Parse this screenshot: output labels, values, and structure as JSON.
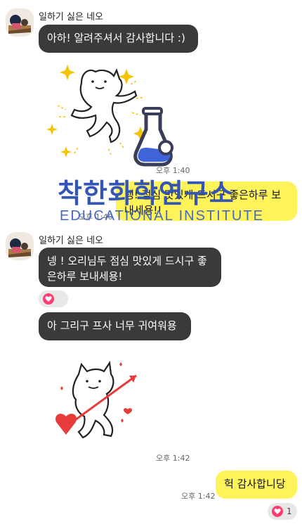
{
  "messages": {
    "group1": {
      "sender": "일하기 싫은 네오",
      "text": "아하! 알려주셔서 감사합니다 :)",
      "sticker": "neo-dancing-sticker",
      "time": "오후 1:40"
    },
    "out1": {
      "text": "넹! 점심 맛있게 드시구 좋은하루 보내세용!!",
      "time": "오후 1:40"
    },
    "group2": {
      "sender": "일하기 싫은 네오",
      "text": "넹 ! 오리님두 점심 맛있게 드시구 좋은하루 보내세용!",
      "text2": "아 그리구 프사 너무 귀여워용",
      "sticker": "neo-heart-arrow-sticker",
      "time": "오후 1:42",
      "reaction_count": "1"
    },
    "out2": {
      "text": "헉 감사합니당",
      "time": "오후 1:42",
      "reaction_count": "1"
    }
  },
  "watermark": {
    "korean": "착한화학연구소",
    "english": "EDUCATIONAL INSTITUTE",
    "logo": "flask-icon"
  },
  "colors": {
    "incoming_bubble": "#3a3a3a",
    "outgoing_bubble": "#fff35a",
    "heart": "#ff3d6e",
    "watermark": "#3355b8"
  }
}
